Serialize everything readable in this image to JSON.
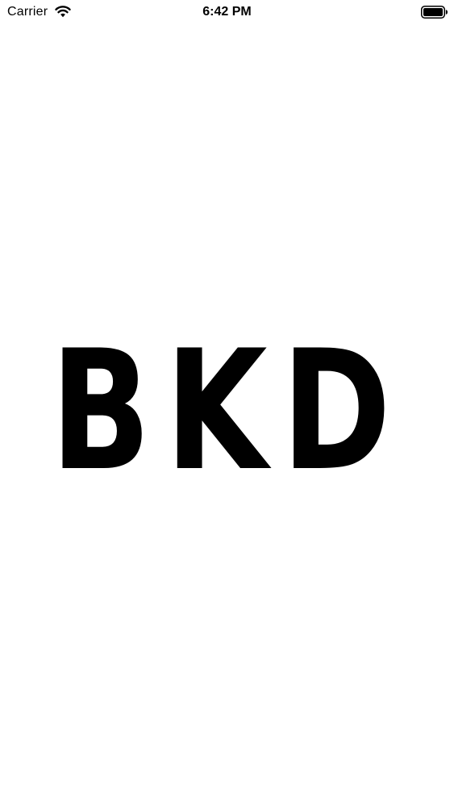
{
  "status_bar": {
    "carrier": "Carrier",
    "time": "6:42 PM",
    "wifi_icon": "wifi-icon",
    "battery_icon": "battery-icon"
  },
  "splash": {
    "logo_text": "BKD",
    "logo_color": "#000000",
    "background_color": "#ffffff"
  }
}
